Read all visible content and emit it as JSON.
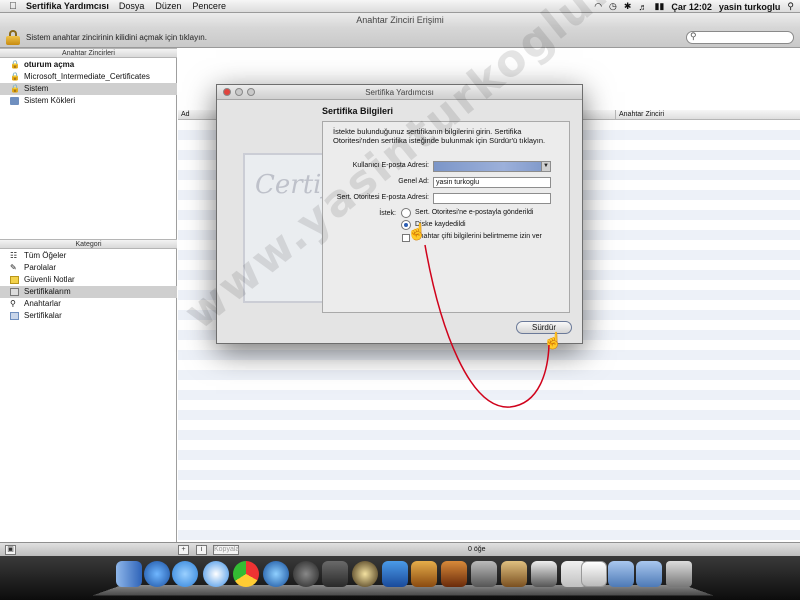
{
  "menubar": {
    "app_name": "Sertifika Yardımcısı",
    "items": [
      "Dosya",
      "Düzen",
      "Pencere"
    ],
    "clock": "Çar 12:02",
    "user": "yasin turkoglu"
  },
  "window": {
    "title": "Anahtar Zinciri Erişimi",
    "lock_message": "Sistem anahtar zincirinin kilidini açmak için tıklayın."
  },
  "keychains": {
    "header": "Anahtar Zincirleri",
    "items": [
      {
        "label": "oturum açma",
        "icon": "lock-icon",
        "bold": true
      },
      {
        "label": "Microsoft_Intermediate_Certificates",
        "icon": "lock-icon"
      },
      {
        "label": "Sistem",
        "icon": "lock-icon",
        "selected": true
      },
      {
        "label": "Sistem Kökleri",
        "icon": "folder-icon"
      }
    ]
  },
  "categories": {
    "header": "Kategori",
    "items": [
      {
        "label": "Tüm Öğeler",
        "icon": "all-items-icon"
      },
      {
        "label": "Parolalar",
        "icon": "password-icon"
      },
      {
        "label": "Güvenli Notlar",
        "icon": "note-icon"
      },
      {
        "label": "Sertifikalarım",
        "icon": "my-certificate-icon",
        "selected": true
      },
      {
        "label": "Anahtarlar",
        "icon": "key-icon"
      },
      {
        "label": "Sertifikalar",
        "icon": "certificate-icon"
      }
    ]
  },
  "list": {
    "col_name": "Ad",
    "col_keychain": "Anahtar Zinciri"
  },
  "bottom": {
    "copy_label": "Kopyala",
    "count": "0 öğe"
  },
  "dialog": {
    "title": "Sertifika Yardımcısı",
    "heading": "Sertifika Bilgileri",
    "intro": "İstekte bulunduğunuz sertifikanın bilgilerini girin. Sertifika Otoritesi'nden sertifika isteğinde bulunmak için Sürdür'ü tıklayın.",
    "email_label": "Kullanıcı E-posta Adresi:",
    "email_value": "",
    "name_label": "Genel Ad:",
    "name_value": "yasin turkoglu",
    "ca_email_label": "Sert. Otoritesi E-posta Adresi:",
    "ca_email_value": "",
    "request_label": "İstek:",
    "options": [
      "Sert. Otoritesi'ne e-postayla gönderildi",
      "Diske kaydedildi"
    ],
    "selected_option": 1,
    "checkbox_label": "Anahtar çifti bilgilerini belirtmeme izin ver",
    "continue_button": "Sürdür"
  },
  "watermark": "www.yasinturkoglu.com",
  "colors": {
    "selection": "#cfcfcf",
    "stripe": "#edf1f8",
    "annotation": "#d0021b"
  }
}
